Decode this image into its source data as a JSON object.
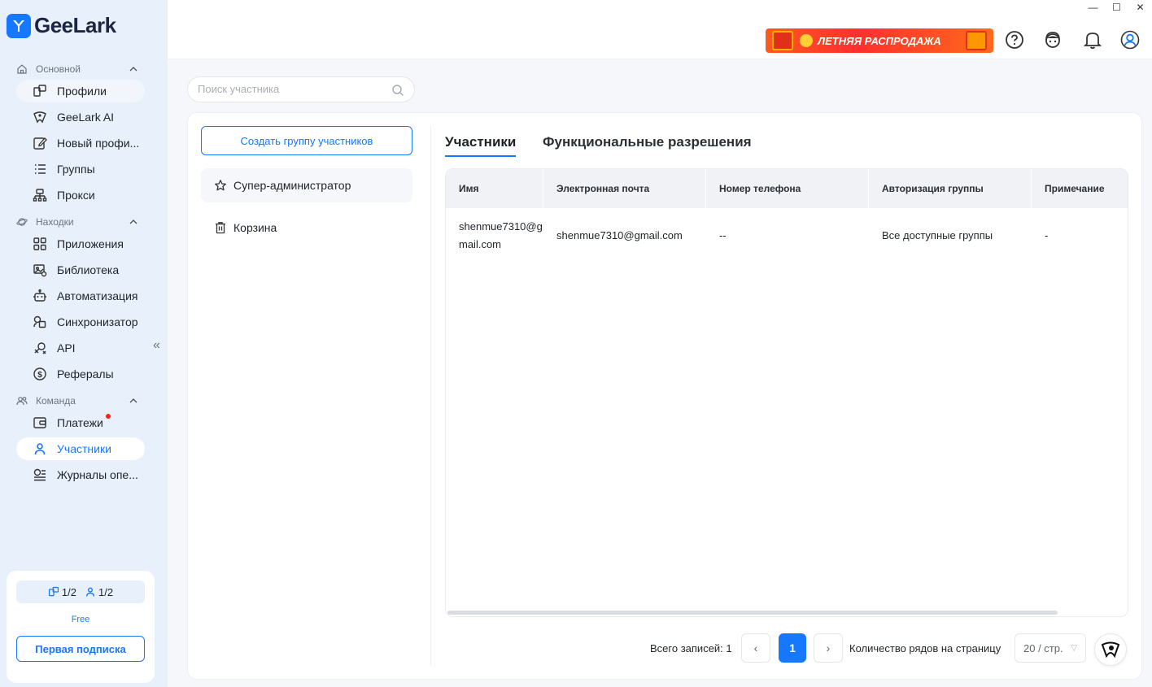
{
  "app": {
    "name": "GeeLark"
  },
  "sidebar": {
    "sections": [
      {
        "label": "Основной",
        "icon": "home-icon"
      },
      {
        "label": "Находки",
        "icon": "planet-icon"
      },
      {
        "label": "Команда",
        "icon": "team-icon"
      }
    ],
    "items": [
      {
        "label": "Профили",
        "icon": "profiles-icon"
      },
      {
        "label": "GeeLark AI",
        "icon": "ai-icon"
      },
      {
        "label": "Новый профиль",
        "icon": "edit-icon"
      },
      {
        "label": "Группы",
        "icon": "list-icon"
      },
      {
        "label": "Прокси",
        "icon": "proxy-icon"
      },
      {
        "label": "Приложения",
        "icon": "apps-icon"
      },
      {
        "label": "Библиотека",
        "icon": "library-icon"
      },
      {
        "label": "Автоматизация",
        "icon": "robot-icon"
      },
      {
        "label": "Синхронизатор",
        "icon": "sync-icon"
      },
      {
        "label": "API",
        "icon": "api-icon"
      },
      {
        "label": "Рефералы",
        "icon": "dollar-icon"
      },
      {
        "label": "Платежи",
        "icon": "wallet-icon"
      },
      {
        "label": "Участники",
        "icon": "user-icon"
      },
      {
        "label": "Журналы операций",
        "icon": "log-icon"
      }
    ],
    "items_display": [
      "Профили",
      "GeeLark AI",
      "Новый профи...",
      "Группы",
      "Прокси",
      "Приложения",
      "Библиотека",
      "Автоматизация",
      "Синхронизатор",
      "API",
      "Рефералы",
      "Платежи",
      "Участники",
      "Журналы опе..."
    ],
    "collapse_glyph": "«",
    "plan": {
      "profiles_quota": "1/2",
      "members_quota": "1/2",
      "name": "Free",
      "button_label": "Первая подписка"
    }
  },
  "topbar": {
    "promo_label": "ЛЕТНЯЯ РАСПРОДАЖА",
    "window_controls": [
      "—",
      "☐",
      "✕"
    ]
  },
  "search": {
    "placeholder": "Поиск участника"
  },
  "groups_panel": {
    "create_button": "Создать группу участников",
    "items": [
      {
        "label": "Супер-администратор",
        "icon": "star-icon"
      },
      {
        "label": "Корзина",
        "icon": "trash-icon"
      }
    ]
  },
  "tabs": [
    {
      "label": "Участники",
      "active": true
    },
    {
      "label": "Функциональные разрешения",
      "active": false
    }
  ],
  "table": {
    "columns": [
      "Имя",
      "Электронная почта",
      "Номер телефона",
      "Авторизация группы",
      "Примечание"
    ],
    "rows": [
      {
        "name": "shenmue7310@gmail.com",
        "email": "shenmue7310@gmail.com",
        "phone": "--",
        "group_auth": "Все доступные группы",
        "note": "-"
      }
    ]
  },
  "pagination": {
    "total_label": "Всего записей: 1",
    "current_page": "1",
    "prev": "‹",
    "next": "›",
    "rows_label": "Количество рядов на страницу",
    "page_size": "20 / стр."
  },
  "colors": {
    "accent": "#1677ff",
    "sidebar_bg": "#e8f0fb",
    "promo": "#ff3b2f",
    "notification_dot": "#ff1f1f"
  }
}
